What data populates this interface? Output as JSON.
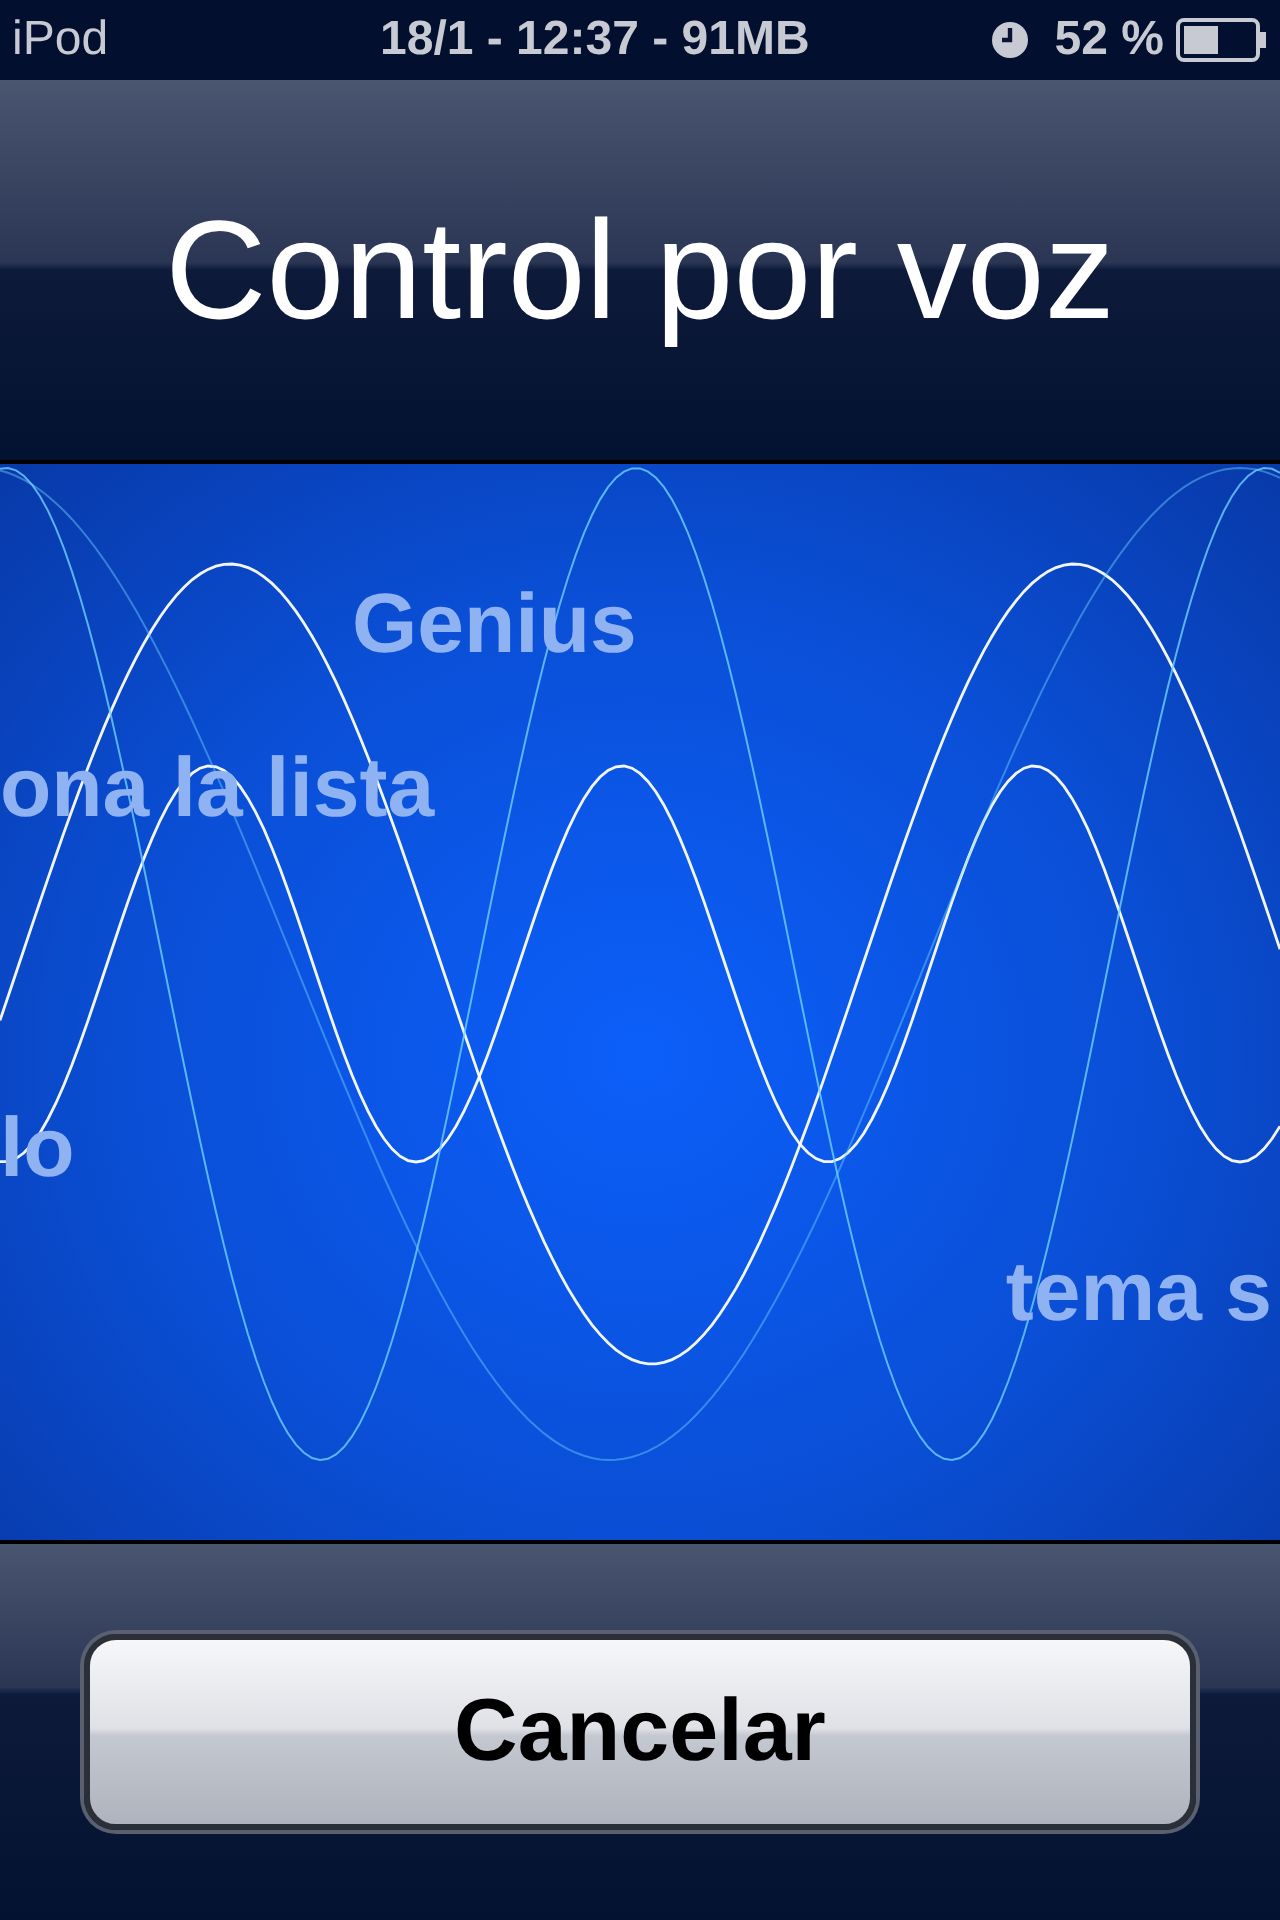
{
  "status_bar": {
    "carrier": "iPod",
    "center": "18/1 - 12:37 - 91MB",
    "battery_percent": "52 %"
  },
  "title": "Control por voz",
  "suggestions": [
    {
      "text": "Genius",
      "kind": "top"
    },
    {
      "text": "ona la lista",
      "kind": "left"
    },
    {
      "text": "lo",
      "kind": "edge"
    },
    {
      "text": "tema s",
      "kind": "right"
    }
  ],
  "cancel_button": "Cancelar"
}
